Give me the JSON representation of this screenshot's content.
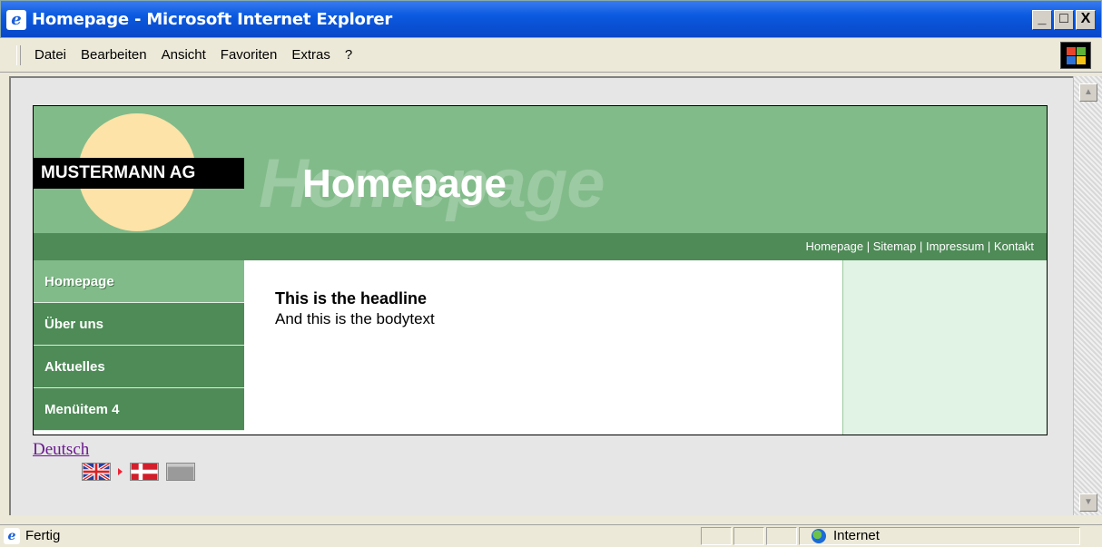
{
  "window": {
    "title": "Homepage - Microsoft Internet Explorer",
    "icon": "internet-explorer-icon",
    "buttons": {
      "minimize": "_",
      "maximize": "□",
      "close": "X"
    }
  },
  "menubar": {
    "items": [
      "Datei",
      "Bearbeiten",
      "Ansicht",
      "Favoriten",
      "Extras",
      "?"
    ]
  },
  "site": {
    "company": "MUSTERMANN AG",
    "hero_title": "Homepage",
    "hero_ghost": "Homepage",
    "topnav": [
      "Homepage",
      "Sitemap",
      "Impressum",
      "Kontakt"
    ],
    "topnav_separator": " | ",
    "sidenav": [
      "Homepage",
      "Über uns",
      "Aktuelles",
      "Menüitem 4"
    ],
    "active_nav": "Homepage",
    "headline": "This is the headline",
    "bodytext": "And this is the bodytext",
    "colors": {
      "header_green": "#82bb8a",
      "dark_green": "#4e8b57",
      "right_column": "#e1f3e4",
      "sun": "#fde3a7"
    }
  },
  "language": {
    "link": "Deutsch",
    "flags": [
      "flag-uk-icon",
      "flag-denmark-icon",
      "flag-blank-icon"
    ]
  },
  "statusbar": {
    "status": "Fertig",
    "zone": "Internet"
  }
}
